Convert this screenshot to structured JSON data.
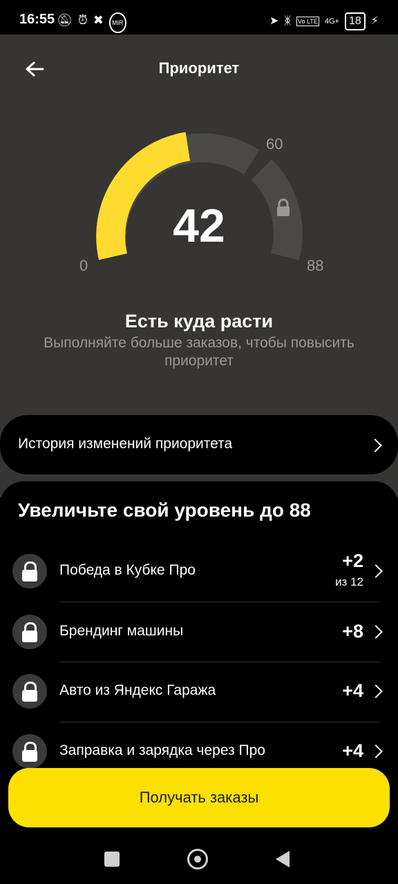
{
  "status_bar": {
    "time": "16:55",
    "left_icons": [
      "bell-off-icon",
      "alarm-icon",
      "app-icon",
      "mir-icon"
    ],
    "mir_label": "MIR",
    "signal_label": "4G+",
    "volte_label": "Vo LTE",
    "battery": "18"
  },
  "header": {
    "title": "Приоритет"
  },
  "gauge": {
    "value": "42",
    "current": 42,
    "min_label": "0",
    "mid_label": "60",
    "max_label": "88",
    "accent_color": "#fddc2f",
    "track_color": "#4a4946"
  },
  "status": {
    "title": "Есть куда расти",
    "description": "Выполняйте больше заказов, чтобы повысить приоритет"
  },
  "history": {
    "label": "История изменений приоритета"
  },
  "levels": {
    "title": "Увеличьте свой уровень до 88",
    "items": [
      {
        "label": "Победа в Кубке Про",
        "value": "+2",
        "sub": "из 12"
      },
      {
        "label": "Брендинг машины",
        "value": "+8"
      },
      {
        "label": "Авто из Яндекс Гаража",
        "value": "+4"
      },
      {
        "label": "Заправка и зарядка через Про",
        "value": "+4"
      }
    ]
  },
  "cta": {
    "label": "Получать заказы",
    "color": "#fce000"
  },
  "nav": {
    "icons": [
      "recents-icon",
      "home-icon",
      "back-icon"
    ]
  }
}
